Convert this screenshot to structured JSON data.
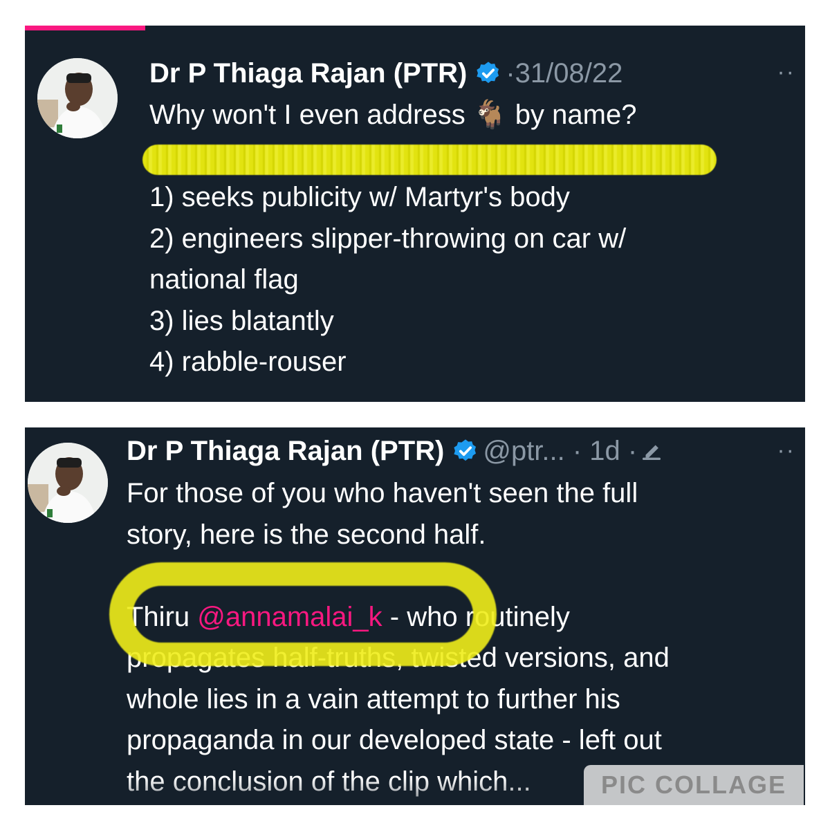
{
  "colors": {
    "background": "#15202b",
    "text": "#ffffff",
    "muted": "#8b98a5",
    "verified_blue": "#1d9bf0",
    "mention_pink": "#f91880",
    "highlighter_yellow": "#f0ee1a"
  },
  "tweet1": {
    "author_name": "Dr P Thiaga Rajan (PTR)",
    "verified_icon": "verified-badge-icon",
    "date": "·31/08/22",
    "more_label": "··",
    "lines": [
      "Why won't I even address 🐐 by name?",
      "1) seeks publicity w/ Martyr's body",
      "2) engineers slipper-throwing on car w/",
      "national flag",
      "3) lies blatantly",
      "4) rabble-rouser"
    ]
  },
  "tweet2": {
    "author_name": "Dr P Thiaga Rajan (PTR)",
    "verified_icon": "verified-badge-icon",
    "handle_time": "@ptr... · 1d ·",
    "edit_icon": "edit-pencil-icon",
    "more_label": "··",
    "lines": [
      "For those of you who haven't seen the full",
      "story, here is the second half.",
      "Thiru ",
      "@annamalai_k",
      " - who routinely",
      "propagates half-truths, twisted versions, and",
      "whole lies in a vain attempt to further his",
      "propaganda in our developed state - left out",
      "the conclusion of the clip which..."
    ]
  },
  "watermark": "PIC COLLAGE"
}
